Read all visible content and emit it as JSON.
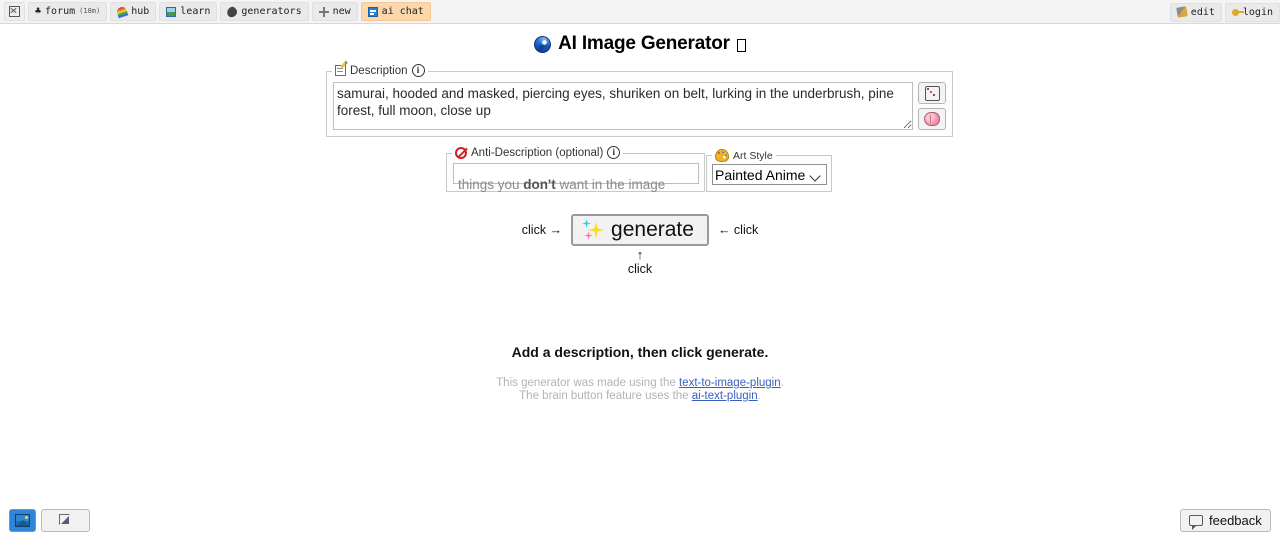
{
  "nav": {
    "left_items": [
      {
        "label": "",
        "icon": "close-box-icon",
        "sup": "",
        "active": false,
        "name": "nav-item-home"
      },
      {
        "label": "forum",
        "icon": "forum-icon",
        "sup": "(18m)",
        "active": false,
        "name": "nav-item-forum"
      },
      {
        "label": "hub",
        "icon": "rainbow-icon",
        "sup": "",
        "active": false,
        "name": "nav-item-hub"
      },
      {
        "label": "learn",
        "icon": "learn-icon",
        "sup": "",
        "active": false,
        "name": "nav-item-learn"
      },
      {
        "label": "generators",
        "icon": "generators-icon",
        "sup": "",
        "active": false,
        "name": "nav-item-generators"
      },
      {
        "label": "new",
        "icon": "plus-icon",
        "sup": "",
        "active": false,
        "name": "nav-item-new"
      },
      {
        "label": "ai chat",
        "icon": "ai-chat-icon",
        "sup": "",
        "active": true,
        "name": "nav-item-ai-chat"
      }
    ],
    "right_items": [
      {
        "label": "edit",
        "icon": "edit-icon",
        "name": "nav-item-edit"
      },
      {
        "label": "login",
        "icon": "key-icon",
        "name": "nav-item-login"
      }
    ]
  },
  "header": {
    "title": "AI Image Generator",
    "trailing_glyph": "tofu-box"
  },
  "description": {
    "legend": "Description",
    "value": "samurai, hooded and masked, piercing eyes, shuriken on belt, lurking in the underbrush, pine forest, full moon, close up",
    "placeholder": "",
    "randomize_title": "dice-button",
    "brain_title": "brain-button"
  },
  "anti_description": {
    "legend": "Anti-Description (optional)",
    "placeholder_prefix": "things you ",
    "placeholder_bold": "don't",
    "placeholder_suffix": " want in the image",
    "value": ""
  },
  "art_style": {
    "legend": "Art Style",
    "selected": "Painted Anime",
    "options": [
      "Painted Anime"
    ]
  },
  "generate": {
    "label": "generate",
    "hint_left": "click →",
    "hint_right": "← click",
    "hint_below_arrow": "↑",
    "hint_below": "click"
  },
  "status": {
    "text_prefix": "Add a description, then click ",
    "text_bold": "generate",
    "text_suffix": "."
  },
  "credits": {
    "line1_prefix": "This generator was made using the ",
    "line1_link": "text-to-image-plugin",
    "line1_suffix": ".",
    "line2_prefix": "The brain button feature uses the ",
    "line2_link": "ai-text-plugin",
    "line2_suffix": "."
  },
  "bottom_bar": {
    "image_tool": "image-tool",
    "cursor_tool": "cursor-tool",
    "feedback_label": "feedback"
  },
  "colors": {
    "active_tab": "#fbd7ab",
    "nav_bg": "#f4f4f4",
    "link": "#3b5fc0",
    "title_icon": "#1f6fd8",
    "muted_text": "#b3b3b3"
  }
}
